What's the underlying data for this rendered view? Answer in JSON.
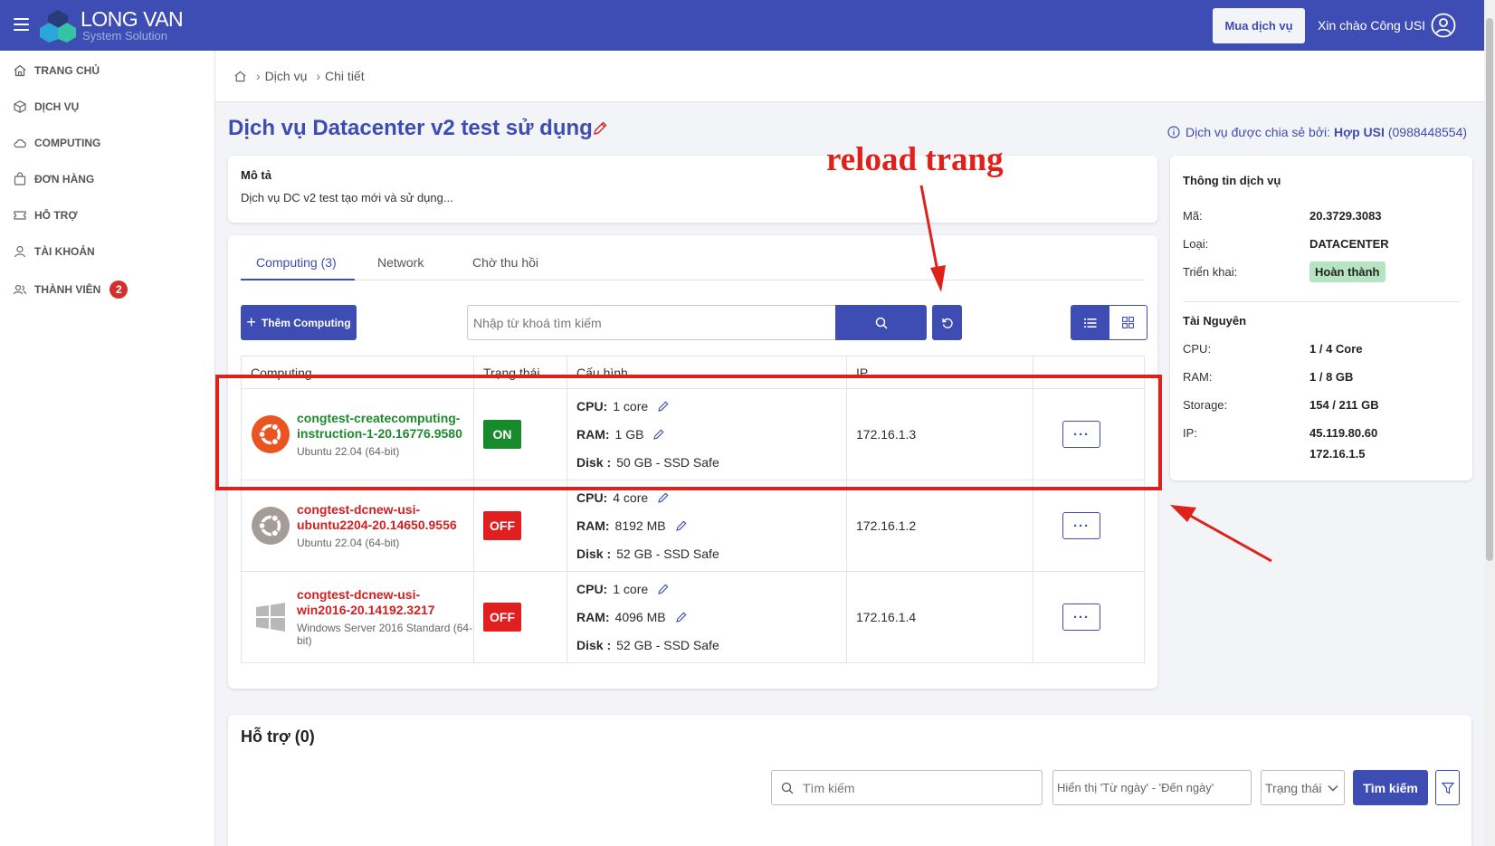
{
  "header": {
    "logo_line1": "LONG VAN",
    "logo_line2": "System Solution",
    "buy_label": "Mua dịch vụ",
    "greeting": "Xin chào Công USI"
  },
  "sidebar": {
    "items": [
      {
        "label": "TRANG CHỦ",
        "icon": "home-icon"
      },
      {
        "label": "DỊCH VỤ",
        "icon": "cube-icon"
      },
      {
        "label": "COMPUTING",
        "icon": "cloud-icon"
      },
      {
        "label": "ĐƠN HÀNG",
        "icon": "bag-icon"
      },
      {
        "label": "HỖ TRỢ",
        "icon": "ticket-icon"
      },
      {
        "label": "TÀI KHOẢN",
        "icon": "user-icon"
      },
      {
        "label": "THÀNH VIÊN",
        "icon": "users-icon",
        "badge": "2"
      }
    ]
  },
  "breadcrumb": {
    "items": [
      "Dịch vụ",
      "Chi tiết"
    ]
  },
  "page": {
    "title": "Dịch vụ Datacenter v2 test sử dụng",
    "shared_label": "Dịch vụ được chia sẻ bởi:",
    "shared_name": "Hợp USI",
    "shared_phone": "(0988448554)"
  },
  "description": {
    "heading": "Mô tả",
    "text": "Dịch vụ DC v2 test tạo mới và sử dụng..."
  },
  "tabs": [
    {
      "label": "Computing (3)",
      "active": true
    },
    {
      "label": "Network",
      "active": false
    },
    {
      "label": "Chờ thu hồi",
      "active": false
    }
  ],
  "toolbar": {
    "add_label": "Thêm Computing",
    "search_placeholder": "Nhập từ khoá tìm kiếm"
  },
  "table": {
    "columns": [
      "Computing",
      "Trạng thái",
      "Cấu hình",
      "IP",
      ""
    ],
    "rows": [
      {
        "name": "congtest-createcomputing-instruction-1-20.16776.9580",
        "os": "Ubuntu 22.04 (64-bit)",
        "os_icon": "ubuntu-icon",
        "status": "ON",
        "cpu": "1 core",
        "ram": "1 GB",
        "disk": "50 GB - SSD Safe",
        "ip": "172.16.1.3"
      },
      {
        "name": "congtest-dcnew-usi-ubuntu2204-20.14650.9556",
        "os": "Ubuntu 22.04 (64-bit)",
        "os_icon": "ubuntu-icon",
        "status": "OFF",
        "cpu": "4 core",
        "ram": "8192 MB",
        "disk": "52 GB - SSD Safe",
        "ip": "172.16.1.2"
      },
      {
        "name": "congtest-dcnew-usi-win2016-20.14192.3217",
        "os": "Windows Server 2016 Standard (64-bit)",
        "os_icon": "windows-icon",
        "status": "OFF",
        "cpu": "1 core",
        "ram": "4096 MB",
        "disk": "52 GB - SSD Safe",
        "ip": "172.16.1.4"
      }
    ],
    "cpu_label": "CPU:",
    "ram_label": "RAM:",
    "disk_label": "Disk :",
    "more_label": "···"
  },
  "info": {
    "heading": "Thông tin dịch vụ",
    "code_label": "Mã:",
    "code": "20.3729.3083",
    "type_label": "Loại:",
    "type": "DATACENTER",
    "deploy_label": "Triển khai:",
    "deploy": "Hoàn thành",
    "resources_heading": "Tài Nguyên",
    "cpu_label": "CPU:",
    "cpu": "1 / 4 Core",
    "ram_label": "RAM:",
    "ram": "1 / 8 GB",
    "storage_label": "Storage:",
    "storage": "154 / 211 GB",
    "ip_label": "IP:",
    "ip1": "45.119.80.60",
    "ip2": "172.16.1.5"
  },
  "support": {
    "title": "Hỗ trợ (0)",
    "search_placeholder": "Tìm kiếm",
    "date_placeholder": "Hiển thị 'Từ ngày' - 'Đến ngày'",
    "status_label": "Trạng thái",
    "find_label": "Tìm kiếm"
  },
  "annotation": {
    "text": "reload trang"
  },
  "colors": {
    "primary": "#3d4db3",
    "on": "#178a2b",
    "off": "#e02020",
    "annotation": "#e0201a"
  }
}
